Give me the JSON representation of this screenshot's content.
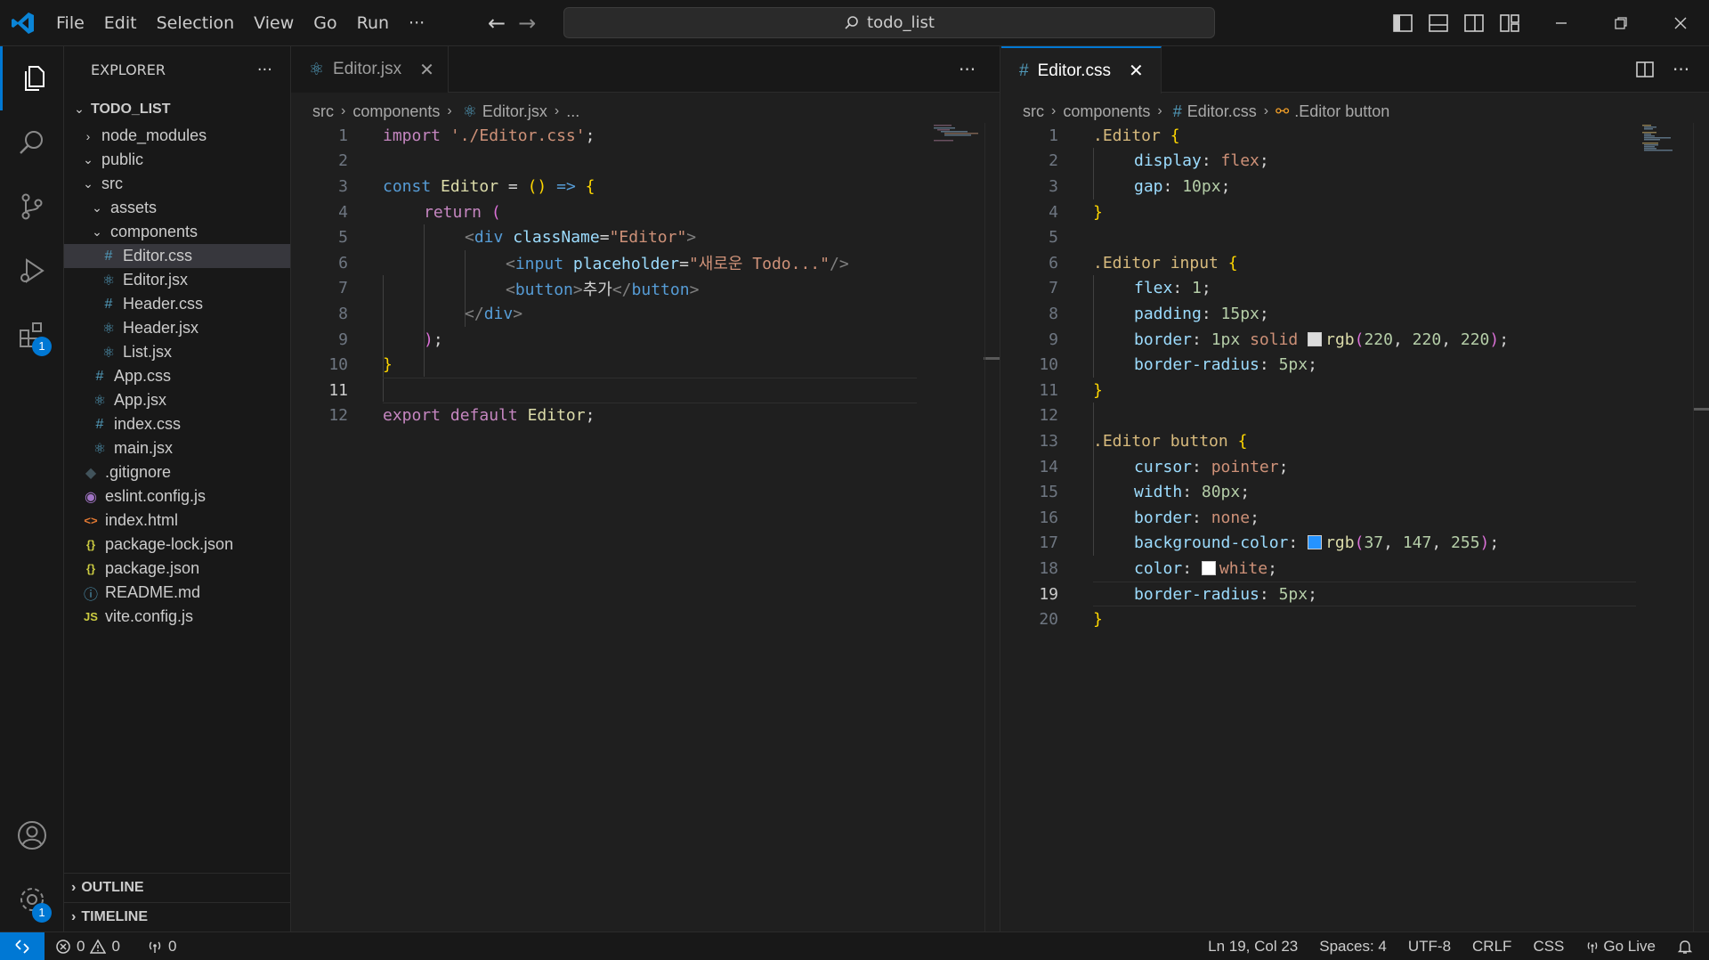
{
  "titlebar": {
    "menu": [
      "File",
      "Edit",
      "Selection",
      "View",
      "Go",
      "Run",
      "···"
    ],
    "search_text": "todo_list"
  },
  "activity_badges": {
    "extensions": "1",
    "settings": "1"
  },
  "sidebar": {
    "title": "EXPLORER",
    "more": "···",
    "root": "TODO_LIST",
    "items": [
      {
        "label": "node_modules",
        "type": "folder",
        "expanded": false,
        "depth": 1
      },
      {
        "label": "public",
        "type": "folder",
        "expanded": true,
        "depth": 1
      },
      {
        "label": "src",
        "type": "folder",
        "expanded": true,
        "depth": 1
      },
      {
        "label": "assets",
        "type": "folder",
        "expanded": true,
        "depth": 2
      },
      {
        "label": "components",
        "type": "folder",
        "expanded": true,
        "depth": 2
      },
      {
        "label": "Editor.css",
        "type": "css",
        "depth": 3,
        "selected": true
      },
      {
        "label": "Editor.jsx",
        "type": "react",
        "depth": 3
      },
      {
        "label": "Header.css",
        "type": "css",
        "depth": 3
      },
      {
        "label": "Header.jsx",
        "type": "react",
        "depth": 3
      },
      {
        "label": "List.jsx",
        "type": "react",
        "depth": 3
      },
      {
        "label": "App.css",
        "type": "css",
        "depth": 2
      },
      {
        "label": "App.jsx",
        "type": "react",
        "depth": 2
      },
      {
        "label": "index.css",
        "type": "css",
        "depth": 2
      },
      {
        "label": "main.jsx",
        "type": "react",
        "depth": 2
      },
      {
        "label": ".gitignore",
        "type": "git",
        "depth": 1
      },
      {
        "label": "eslint.config.js",
        "type": "eslint",
        "depth": 1
      },
      {
        "label": "index.html",
        "type": "html",
        "depth": 1
      },
      {
        "label": "package-lock.json",
        "type": "json",
        "depth": 1
      },
      {
        "label": "package.json",
        "type": "json",
        "depth": 1
      },
      {
        "label": "README.md",
        "type": "info",
        "depth": 1
      },
      {
        "label": "vite.config.js",
        "type": "js",
        "depth": 1
      }
    ],
    "outline": "OUTLINE",
    "timeline": "TIMELINE"
  },
  "left_editor": {
    "tab": "Editor.jsx",
    "breadcrumb": [
      "src",
      "components",
      "Editor.jsx",
      "..."
    ],
    "current_line": 11
  },
  "right_editor": {
    "tab": "Editor.css",
    "breadcrumb": [
      "src",
      "components",
      "Editor.css",
      ".Editor button"
    ],
    "current_line": 19
  },
  "colors": {
    "accent": "#0078d4",
    "swatch_gray": "#dcdcdc",
    "swatch_blue": "#2593ff",
    "swatch_white": "#ffffff"
  },
  "statusbar": {
    "errors": "0",
    "warnings": "0",
    "ports": "0",
    "position": "Ln 19, Col 23",
    "spaces": "Spaces: 4",
    "encoding": "UTF-8",
    "eol": "CRLF",
    "language": "CSS",
    "golive": "Go Live"
  }
}
